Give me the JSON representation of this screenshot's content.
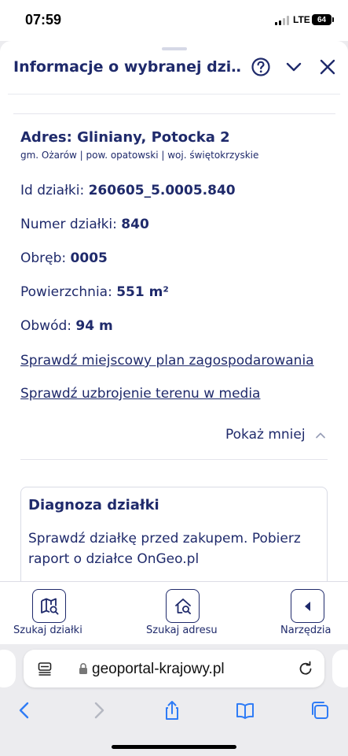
{
  "status_bar": {
    "time": "07:59",
    "network": "LTE",
    "battery": "64"
  },
  "sheet": {
    "title": "Informacje o wybranej dzi…",
    "address_title": "Adres: Gliniany, Potocka 2",
    "address_sub": "gm. Ożarów | pow. opatowski | woj. świętokrzyskie",
    "fields": [
      {
        "label": "Id działki: ",
        "value": "260605_5.0005.840"
      },
      {
        "label": "Numer działki: ",
        "value": "840"
      },
      {
        "label": "Obręb: ",
        "value": "0005"
      },
      {
        "label": "Powierzchnia: ",
        "value": "551 m²"
      },
      {
        "label": "Obwód: ",
        "value": "94 m"
      }
    ],
    "links": [
      "Sprawdź miejscowy plan zagospodarowania",
      "Sprawdź uzbrojenie terenu w media"
    ],
    "show_less": "Pokaż mniej",
    "diagnosis": {
      "title": "Diagnoza działki",
      "text": "Sprawdź działkę przed zakupem. Pobierz raport o działce OnGeo.pl"
    }
  },
  "tabbar": {
    "items": [
      {
        "label": "Szukaj działki",
        "icon": "map-search-icon"
      },
      {
        "label": "Szukaj adresu",
        "icon": "home-search-icon"
      },
      {
        "label": "Narzędzia",
        "icon": "arrow-left-icon"
      }
    ]
  },
  "browser": {
    "url": "geoportal-krajowy.pl"
  },
  "colors": {
    "brand": "#1f2a6b",
    "link_blue": "#2f7cf6"
  }
}
